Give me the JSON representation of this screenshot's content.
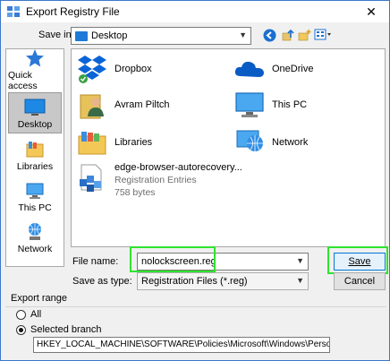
{
  "window": {
    "title": "Export Registry File",
    "close_glyph": "✕"
  },
  "save_in": {
    "label": "Save in:",
    "value": "Desktop",
    "toolbar_icons": [
      "back-icon",
      "up-folder-icon",
      "new-folder-icon",
      "view-menu-icon"
    ]
  },
  "places": [
    {
      "label": "Quick access",
      "icon": "star-icon",
      "selected": false
    },
    {
      "label": "Desktop",
      "icon": "desktop-icon",
      "selected": true
    },
    {
      "label": "Libraries",
      "icon": "libraries-icon",
      "selected": false
    },
    {
      "label": "This PC",
      "icon": "computer-icon",
      "selected": false
    },
    {
      "label": "Network",
      "icon": "network-icon",
      "selected": false
    }
  ],
  "files": [
    {
      "name": "Dropbox",
      "icon": "dropbox-icon"
    },
    {
      "name": "OneDrive",
      "icon": "onedrive-icon"
    },
    {
      "name": "Avram Piltch",
      "icon": "user-folder-icon"
    },
    {
      "name": "This PC",
      "icon": "computer-icon"
    },
    {
      "name": "Libraries",
      "icon": "libraries-icon"
    },
    {
      "name": "Network",
      "icon": "network-icon"
    },
    {
      "name": "edge-browser-autorecovery...",
      "type": "Registration Entries",
      "size": "758 bytes",
      "icon": "registry-file-icon"
    }
  ],
  "file_name": {
    "label": "File name:",
    "value": "nolockscreen.reg"
  },
  "save_as_type": {
    "label": "Save as type:",
    "value": "Registration Files (*.reg)"
  },
  "buttons": {
    "save": "Save",
    "cancel": "Cancel"
  },
  "export_range": {
    "title": "Export range",
    "all_label": "All",
    "selected_label": "Selected branch",
    "selected_option": "selected_branch",
    "branch_path": "HKEY_LOCAL_MACHINE\\SOFTWARE\\Policies\\Microsoft\\Windows\\Personalization"
  },
  "colors": {
    "highlight": "#2ee32e",
    "accent": "#0078d7"
  }
}
